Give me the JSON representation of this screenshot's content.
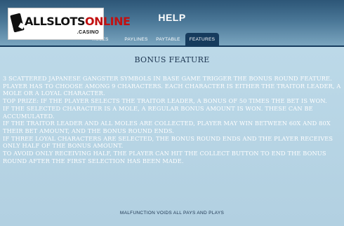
{
  "logo": {
    "brand_main": "ALLSLOTS",
    "brand_accent": "ONLINE",
    "brand_sub": ".CASINO"
  },
  "header": {
    "title": "HELP"
  },
  "tabs": [
    {
      "label": "RULES",
      "active": false
    },
    {
      "label": "PAYLINES",
      "active": false
    },
    {
      "label": "PAYTABLE",
      "active": false
    },
    {
      "label": "FEATURES",
      "active": true
    }
  ],
  "content": {
    "heading": "BONUS FEATURE",
    "paragraphs": [
      "3 SCATTERED JAPANESE GANGSTER SYMBOLS IN BASE GAME TRIGGER THE BONUS ROUND FEATURE.",
      "PLAYER HAS TO CHOOSE AMONG 9 CHARACTERS. EACH CHARACTER IS EITHER THE TRAITOR LEADER, A MOLE OR A LOYAL CHARACTER.",
      "TOP PRIZE: IF THE PLAYER SELECTS THE TRAITOR LEADER, A BONUS OF 50 TIMES THE BET IS WON.",
      "IF THE SELECTED CHARACTER IS A MOLE, A REGULAR BONUS AMOUNT IS WON. THESE CAN BE ACCUMULATED.",
      "IF THE TRAITOR LEADER AND ALL MOLES ARE COLLECTED, PLAYER MAY WIN BETWEEN 60X AND 80X THEIR BET AMOUNT, AND THE BONUS ROUND ENDS.",
      "IF THREE LOYAL CHARACTERS ARE SELECTED, THE BONUS ROUND ENDS AND THE PLAYER RECEIVES ONLY HALF OF THE BONUS AMOUNT.",
      "TO AVOID ONLY RECEIVING HALF, THE PLAYER CAN HIT THE COLLECT BUTTON TO END THE BONUS ROUND AFTER THE FIRST SELECTION HAS BEEN MADE."
    ],
    "footer": "MALFUNCTION VOIDS ALL PAYS AND PLAYS"
  }
}
